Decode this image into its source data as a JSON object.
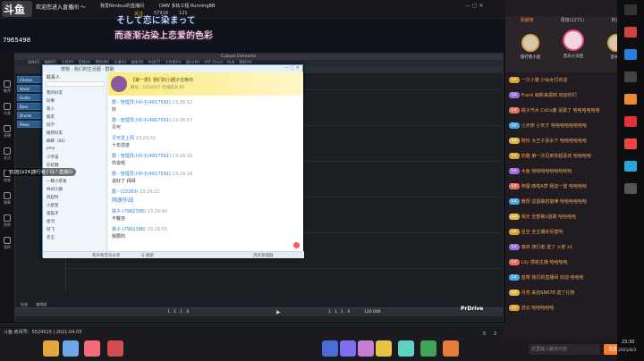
{
  "overlay": {
    "logo": "斗鱼",
    "room_code": "7965498",
    "welcome": "欢迎您进入直播间 ～",
    "lyric_top": "そして恋に染まって",
    "lyric_bottom": "而逐渐沾染上恋爱的色彩",
    "side_notice": "欢迎[LV24]旅行者小鼠人直播间"
  },
  "topbar": {
    "tab1": "我爱Nimbus的直播间",
    "tab2": "DAW 多轨工程 RunningBB",
    "btn_follow": "关注",
    "count1": "57918",
    "count2": "121"
  },
  "leftnav": [
    {
      "label": "推荐"
    },
    {
      "label": "分类"
    },
    {
      "label": "直播"
    },
    {
      "label": "关注"
    },
    {
      "label": "视频"
    },
    {
      "label": "赛事"
    },
    {
      "label": "鱼吧"
    },
    {
      "label": "我的"
    }
  ],
  "daw": {
    "title": "Cubase Elements",
    "menu": [
      "文件(F)",
      "编辑(E)",
      "工程(P)",
      "音频(A)",
      "MIDI(M)",
      "乐谱(S)",
      "媒体(D)",
      "传送(T)",
      "工作室(U)",
      "窗口(W)",
      "VST Cloud",
      "Hub",
      "帮助(H)"
    ],
    "tracks": [
      "Chorus",
      "Vocal",
      "Guitar",
      "Bass",
      "Drums",
      "Piano"
    ],
    "transport": "1 . 1 . 1 . 0",
    "tempo": "120.000",
    "bottom_tabs": [
      "轨道",
      "编辑器"
    ]
  },
  "qq": {
    "title": "宠物 · 我们的生活圈 · 群聊",
    "group_name": "【第一排】我们的小圈子在等你",
    "group_sub": "群号：1234567  在线成员 85",
    "left_header": "联系人",
    "left_list": [
      "我的好友",
      "同事",
      "家人",
      "朋友",
      "同学",
      "推荐好友",
      "群聊（66）",
      "Jelly",
      "小宇宙",
      "彩虹糖",
      "音乐人",
      "一颗小苹果",
      "林间小路",
      "风起时",
      "小星星",
      "夜猫子",
      "星河",
      "阿飞",
      "老王"
    ],
    "messages": [
      {
        "name": "群···管理员小伙子(4917591)",
        "time": "23:28:52",
        "text": "好"
      },
      {
        "name": "群···管理员小伙子(4917591)",
        "time": "23:28:57",
        "text": "贝可"
      },
      {
        "name": "贝可爱上周",
        "time": "23:29:02",
        "text": "十年前进"
      },
      {
        "name": "群···管理员小伙子(4917591)",
        "time": "23:29:10",
        "text": "你说呢"
      },
      {
        "name": "群···管理员小伙子(4917591)",
        "time": "23:29:18",
        "text": "说好了 拜拜"
      },
      {
        "name": "群···(22263)",
        "time": "23:29:22",
        "text": "网速作战"
      },
      {
        "name": "晨子-(7962396)",
        "time": "23:29:40",
        "text": "不戴自"
      },
      {
        "name": "晨子-(7962396)",
        "time": "23:29:55",
        "text": "我要的"
      }
    ],
    "bottom_left": "和声和音乐分享",
    "bottom_mid": "Q 搜索",
    "bottom_right": "消息管理器"
  },
  "bottombar": {
    "room": "斗鱼 房间号：5524515 | 2021.04.03",
    "pro": "PrDrive",
    "live_count": "5",
    "gift_count": "2"
  },
  "rightpanel": {
    "tabs": [
      "贡献榜",
      "周榜(2271)",
      "粉丝团"
    ],
    "rank": [
      {
        "name": "旅行者小鼠",
        "rank": "2"
      },
      {
        "name": "音乐小天后",
        "rank": "1"
      },
      {
        "name": "追光者",
        "rank": "3"
      }
    ],
    "chat": [
      {
        "u": "一只小猫",
        "t": "小仙女们欢迎"
      },
      {
        "u": "Frank",
        "t": "萌新来报到 欢迎你们"
      },
      {
        "u": "橘子汽水",
        "t": "CoCo酱 说歌了 哈哈哈哈哈哈"
      },
      {
        "u": "小天使",
        "t": "小天才 哈哈哈哈哈哈哈哈"
      },
      {
        "u": "阿珍",
        "t": "大王子喜水下 哈哈哈哈哈哈"
      },
      {
        "u": "奶酪",
        "t": "第一次见到你超喜欢 哈哈哈哈"
      },
      {
        "u": "木鱼",
        "t": "哈哈哈哈哈哈哈哈哈"
      },
      {
        "u": "阿狸",
        "t": "哆啦A梦 我这一首 哈哈哈哈"
      },
      {
        "u": "暖阳",
        "t": "这首歌的旋律 哈哈哈哈哈哈"
      },
      {
        "u": "晴天",
        "t": "全部第1首歌 哈哈哈哈"
      },
      {
        "u": "星空",
        "t": "全主播好厉害哟"
      },
      {
        "u": "森林",
        "t": "旅行者 送了 火箭 x1"
      },
      {
        "u": "Lily",
        "t": "感谢主播 哈哈哈哈"
      },
      {
        "u": "蓝莓",
        "t": "我们的直播间 欢迎 哈哈哈"
      },
      {
        "u": "月亮",
        "t": "来自SN678 送了礼物"
      },
      {
        "u": "流云",
        "t": "哈哈哈哈哈"
      }
    ],
    "input_placeholder": "这里输入聊天内容",
    "send": "发送",
    "time": "23:30",
    "date": "2021/4/3"
  },
  "colors": {
    "accent": "#ff7a2d",
    "brand": "#f2b230",
    "qqblue": "#5b9bd5"
  }
}
